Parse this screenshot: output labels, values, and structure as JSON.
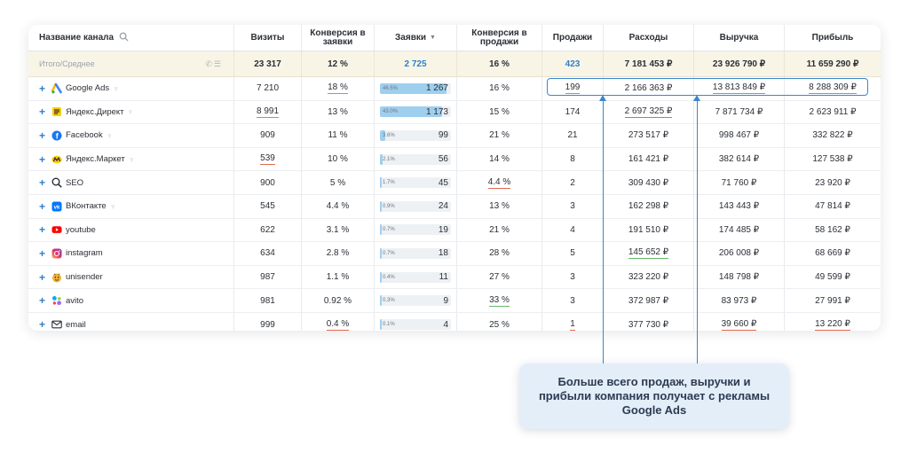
{
  "header": {
    "channel": "Название канала",
    "visits": "Визиты",
    "conversion_to_requests": "Конверсия в заявки",
    "requests": "Заявки",
    "conversion_to_sales": "Конверсия в продажи",
    "sales": "Продажи",
    "expenses": "Расходы",
    "revenue": "Выручка",
    "profit": "Прибыль"
  },
  "totals": {
    "label": "Итого/Среднее",
    "visits": "23 317",
    "conversion_to_requests": "12 %",
    "requests": "2 725",
    "conversion_to_sales": "16 %",
    "sales": "423",
    "expenses": "7 181 453 ₽",
    "revenue": "23 926 790 ₽",
    "profit": "11 659 290 ₽"
  },
  "rows": [
    {
      "channel": "Google Ads",
      "icon": "google-ads-icon",
      "visits": "7 210",
      "conv_req": "18 %",
      "req_pct_label": "46.5%",
      "req_share": 0.465,
      "requests": "1 267",
      "conv_sales": "16 %",
      "sales": "199",
      "expenses": "2 166 363 ₽",
      "revenue": "13 813 849 ₽",
      "profit": "8 288 309 ₽"
    },
    {
      "channel": "Яндекс.Директ",
      "icon": "yandex-direct-icon",
      "visits": "8 991",
      "conv_req": "13 %",
      "req_pct_label": "43.0%",
      "req_share": 0.43,
      "requests": "1 173",
      "conv_sales": "15 %",
      "sales": "174",
      "expenses": "2 697 325 ₽",
      "revenue": "7 871 734 ₽",
      "profit": "2 623 911 ₽"
    },
    {
      "channel": "Facebook",
      "icon": "facebook-icon",
      "visits": "909",
      "conv_req": "11 %",
      "req_pct_label": "3.6%",
      "req_share": 0.036,
      "requests": "99",
      "conv_sales": "21 %",
      "sales": "21",
      "expenses": "273 517 ₽",
      "revenue": "998 467 ₽",
      "profit": "332 822 ₽"
    },
    {
      "channel": "Яндекс.Маркет",
      "icon": "yandex-market-icon",
      "visits": "539",
      "conv_req": "10 %",
      "req_pct_label": "2.1%",
      "req_share": 0.021,
      "requests": "56",
      "conv_sales": "14 %",
      "sales": "8",
      "expenses": "161 421 ₽",
      "revenue": "382 614 ₽",
      "profit": "127 538 ₽"
    },
    {
      "channel": "SEO",
      "icon": "search-icon",
      "visits": "900",
      "conv_req": "5 %",
      "req_pct_label": "1.7%",
      "req_share": 0.017,
      "requests": "45",
      "conv_sales": "4.4 %",
      "sales": "2",
      "expenses": "309 430 ₽",
      "revenue": "71 760 ₽",
      "profit": "23 920 ₽"
    },
    {
      "channel": "ВКонтакте",
      "icon": "vk-icon",
      "visits": "545",
      "conv_req": "4.4 %",
      "req_pct_label": "0.9%",
      "req_share": 0.009,
      "requests": "24",
      "conv_sales": "13 %",
      "sales": "3",
      "expenses": "162 298 ₽",
      "revenue": "143 443 ₽",
      "profit": "47 814 ₽"
    },
    {
      "channel": "youtube",
      "icon": "youtube-icon",
      "visits": "622",
      "conv_req": "3.1 %",
      "req_pct_label": "0.7%",
      "req_share": 0.007,
      "requests": "19",
      "conv_sales": "21 %",
      "sales": "4",
      "expenses": "191 510 ₽",
      "revenue": "174 485 ₽",
      "profit": "58 162 ₽"
    },
    {
      "channel": "instagram",
      "icon": "instagram-icon",
      "visits": "634",
      "conv_req": "2.8 %",
      "req_pct_label": "0.7%",
      "req_share": 0.007,
      "requests": "18",
      "conv_sales": "28 %",
      "sales": "5",
      "expenses": "145 652 ₽",
      "revenue": "206 008 ₽",
      "profit": "68 669 ₽"
    },
    {
      "channel": "unisender",
      "icon": "unisender-icon",
      "visits": "987",
      "conv_req": "1.1 %",
      "req_pct_label": "0.4%",
      "req_share": 0.004,
      "requests": "11",
      "conv_sales": "27 %",
      "sales": "3",
      "expenses": "323 220 ₽",
      "revenue": "148 798 ₽",
      "profit": "49 599 ₽"
    },
    {
      "channel": "avito",
      "icon": "avito-icon",
      "visits": "981",
      "conv_req": "0.92 %",
      "req_pct_label": "0.3%",
      "req_share": 0.003,
      "requests": "9",
      "conv_sales": "33 %",
      "sales": "3",
      "expenses": "372 987 ₽",
      "revenue": "83 973 ₽",
      "profit": "27 991 ₽"
    },
    {
      "channel": "email",
      "icon": "mail-icon",
      "visits": "999",
      "conv_req": "0.4 %",
      "req_pct_label": "0.1%",
      "req_share": 0.001,
      "requests": "4",
      "conv_sales": "25 %",
      "sales": "1",
      "expenses": "377 730 ₽",
      "revenue": "39 660 ₽",
      "profit": "13 220 ₽"
    }
  ],
  "callout": {
    "text": "Больше всего продаж, выручки и прибыли компания получает с рекламы Google Ads"
  },
  "colors": {
    "accent": "#3a86cf",
    "good_underline": "#66b86a",
    "bad_underline": "#e06a52",
    "totals_bg": "#f8f5e6",
    "bar_fill": "#9fcfee"
  }
}
